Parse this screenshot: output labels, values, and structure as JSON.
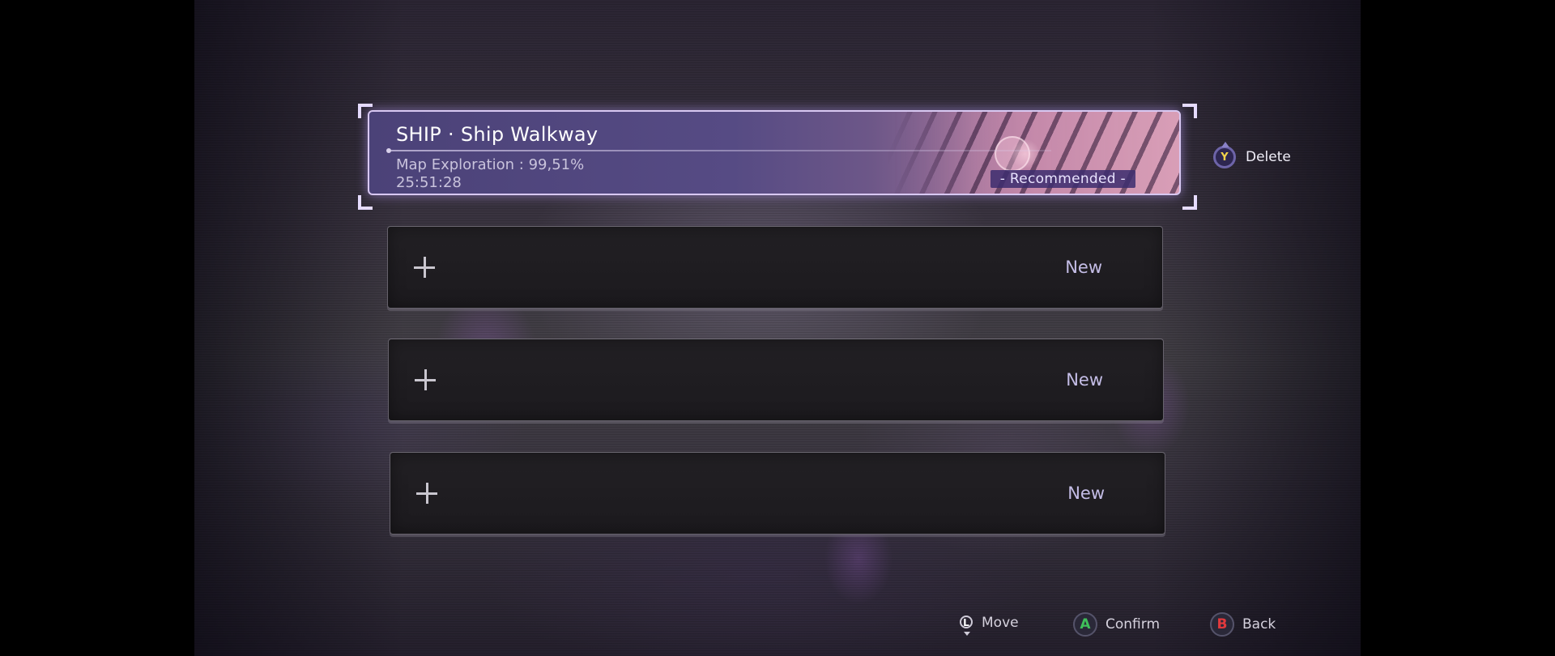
{
  "save_slots": [
    {
      "title": "SHIP · Ship Walkway",
      "map_exploration": "Map Exploration : 99,51%",
      "play_time": "25:51:28",
      "badge": "- Recommended -",
      "selected": true
    },
    {
      "label": "New",
      "icon": "plus-icon"
    },
    {
      "label": "New",
      "icon": "plus-icon"
    },
    {
      "label": "New",
      "icon": "plus-icon"
    }
  ],
  "side_hint": {
    "button": "Y",
    "label": "Delete",
    "button_color": "#f2d34a"
  },
  "footer": {
    "move": {
      "button": "L",
      "label": "Move"
    },
    "confirm": {
      "button": "A",
      "label": "Confirm",
      "button_color": "#3fbf5a"
    },
    "back": {
      "button": "B",
      "label": "Back",
      "button_color": "#e0393d"
    }
  },
  "colors": {
    "accent": "#d8c8f2",
    "selected_slot": "#564b84",
    "new_label": "#c4bde6"
  }
}
